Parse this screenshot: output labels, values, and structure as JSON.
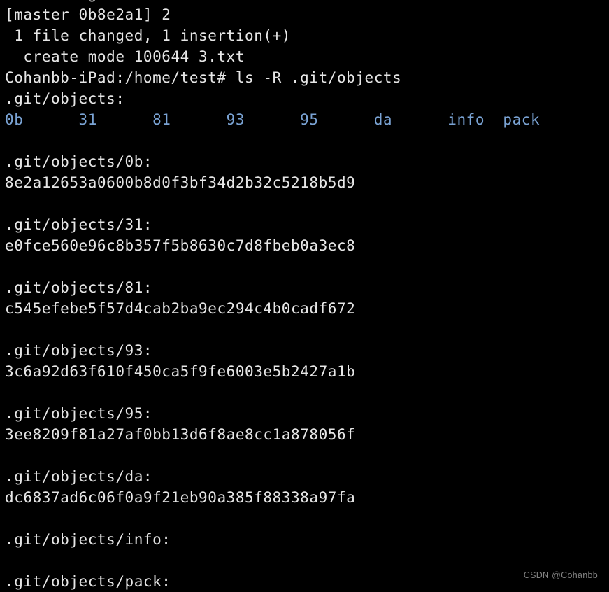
{
  "terminal": {
    "background_color": "#000000",
    "foreground_color": "#e6e6e6",
    "directory_color": "#7aa3d4",
    "partial_top_line": "         g",
    "lines": [
      {
        "text": "[master 0b8e2a1] 2",
        "kind": "output"
      },
      {
        "text": " 1 file changed, 1 insertion(+)",
        "kind": "output"
      },
      {
        "text": "  create mode 100644 3.txt",
        "kind": "output"
      },
      {
        "text": "Cohanbb-iPad:/home/test# ls -R .git/objects",
        "kind": "prompt"
      },
      {
        "text": ".git/objects:",
        "kind": "output"
      },
      {
        "text": "",
        "kind": "dir-row"
      },
      {
        "text": "",
        "kind": "blank"
      },
      {
        "text": ".git/objects/0b:",
        "kind": "output"
      },
      {
        "text": "8e2a12653a0600b8d0f3bf34d2b32c5218b5d9",
        "kind": "output"
      },
      {
        "text": "",
        "kind": "blank"
      },
      {
        "text": ".git/objects/31:",
        "kind": "output"
      },
      {
        "text": "e0fce560e96c8b357f5b8630c7d8fbeb0a3ec8",
        "kind": "output"
      },
      {
        "text": "",
        "kind": "blank"
      },
      {
        "text": ".git/objects/81:",
        "kind": "output"
      },
      {
        "text": "c545efebe5f57d4cab2ba9ec294c4b0cadf672",
        "kind": "output"
      },
      {
        "text": "",
        "kind": "blank"
      },
      {
        "text": ".git/objects/93:",
        "kind": "output"
      },
      {
        "text": "3c6a92d63f610f450ca5f9fe6003e5b2427a1b",
        "kind": "output"
      },
      {
        "text": "",
        "kind": "blank"
      },
      {
        "text": ".git/objects/95:",
        "kind": "output"
      },
      {
        "text": "3ee8209f81a27af0bb13d6f8ae8cc1a878056f",
        "kind": "output"
      },
      {
        "text": "",
        "kind": "blank"
      },
      {
        "text": ".git/objects/da:",
        "kind": "output"
      },
      {
        "text": "dc6837ad6c06f0a9f21eb90a385f88338a97fa",
        "kind": "output"
      },
      {
        "text": "",
        "kind": "blank"
      },
      {
        "text": ".git/objects/info:",
        "kind": "output"
      },
      {
        "text": "",
        "kind": "blank"
      },
      {
        "text": ".git/objects/pack:",
        "kind": "output"
      }
    ],
    "directory_listing_row": "0b      31      81      93      95      da      info  pack",
    "directory_entries": [
      "0b",
      "31",
      "81",
      "93",
      "95",
      "da",
      "info",
      "pack"
    ],
    "prompt": {
      "host": "Cohanbb-iPad",
      "path": "/home/test",
      "symbol": "#",
      "command": "ls -R .git/objects",
      "full": "Cohanbb-iPad:/home/test# ls -R .git/objects"
    },
    "git_commit": {
      "branch": "master",
      "short_hash": "0b8e2a1",
      "message": "2",
      "summary": " 1 file changed, 1 insertion(+)",
      "create_mode": "  create mode 100644 3.txt"
    }
  },
  "watermark": {
    "text": "CSDN @Cohanbb",
    "color": "#8c8c8c"
  }
}
